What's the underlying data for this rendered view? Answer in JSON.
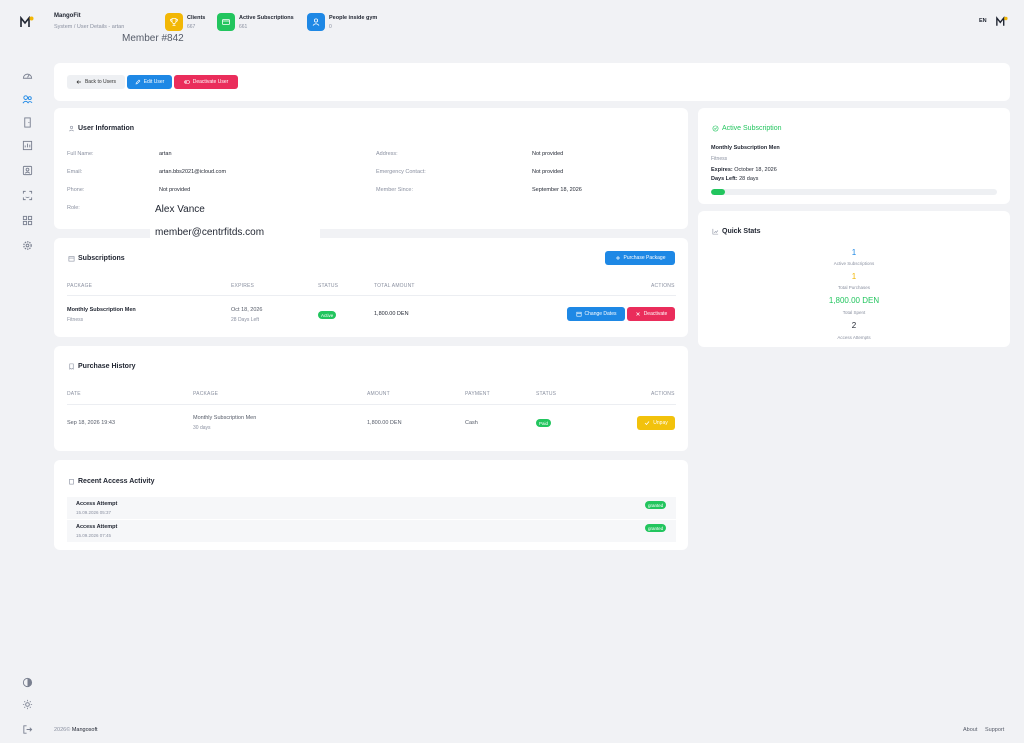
{
  "header": {
    "brand": "MangoFit",
    "breadcrumb": "System  /  User Details - artan",
    "member_label": "Member #842",
    "lang": "EN"
  },
  "stats": [
    {
      "title": "Clients",
      "count": "667",
      "color": "#f2b705",
      "icon": "trophy-icon"
    },
    {
      "title": "Active Subscriptions",
      "count": "661",
      "color": "#22c55e",
      "icon": "card-icon"
    },
    {
      "title": "People inside gym",
      "count": "0",
      "color": "#1e88e5",
      "icon": "person-icon"
    }
  ],
  "actions": {
    "back": "Back to Users",
    "edit": "Edit User",
    "deactivate": "Deactivate User"
  },
  "user_info": {
    "title": "User Information",
    "fields": {
      "full_name": {
        "label": "Full Name:",
        "value": "artan"
      },
      "email": {
        "label": "Email:",
        "value": "artan.bbs2021@icloud.com"
      },
      "phone": {
        "label": "Phone:",
        "value": "Not provided"
      },
      "role": {
        "label": "Role:"
      },
      "address": {
        "label": "Address:",
        "value": "Not provided"
      },
      "emergency": {
        "label": "Emergency Contact:",
        "value": "Not provided"
      },
      "member_since": {
        "label": "Member Since:",
        "value": "September 18, 2026"
      }
    },
    "overlay_name": "Alex Vance",
    "overlay_email": "member@centrfitds.com"
  },
  "subscriptions": {
    "title": "Subscriptions",
    "purchase_button": "Purchase Package",
    "headers": [
      "Package",
      "Expires",
      "Status",
      "Total Amount",
      "Actions"
    ],
    "row": {
      "package": "Monthly Subscription Men",
      "category": "Fitness",
      "expires": "Oct 18, 2026",
      "days_left": "28 Days Left",
      "status": "Active",
      "amount": "1,800.00 DEN",
      "change_dates": "Change Dates",
      "deactivate": "Deactivate"
    }
  },
  "purchase_history": {
    "title": "Purchase History",
    "headers": [
      "Date",
      "Package",
      "Amount",
      "Payment",
      "Status",
      "Actions"
    ],
    "row": {
      "date": "Sep 18, 2026 19:43",
      "package": "Monthly Subscription Men",
      "duration": "30 days",
      "amount": "1,800.00 DEN",
      "payment": "Cash",
      "status": "Paid",
      "action": "Unpay"
    }
  },
  "access_activity": {
    "title": "Recent Access Activity",
    "items": [
      {
        "title": "Access Attempt",
        "time": "15.09.2026 05:37",
        "status": "granted"
      },
      {
        "title": "Access Attempt",
        "time": "15.09.2026 07:45",
        "status": "granted"
      }
    ]
  },
  "active_subscription": {
    "title": "Active Subscription",
    "name": "Monthly Subscription Men",
    "category": "Fitness",
    "expires_label": "Expires:",
    "expires_value": "October 18, 2026",
    "days_label": "Days Left:",
    "days_value": "28 days",
    "progress_fraction": 0.05,
    "accent": "#22c55e"
  },
  "quick_stats": {
    "title": "Quick Stats",
    "items": [
      {
        "value": "1",
        "label": "Active Subscriptions",
        "color": "#1e88e5"
      },
      {
        "value": "1",
        "label": "Total Purchases",
        "color": "#f2b705"
      },
      {
        "value": "1,800.00 DEN",
        "label": "Total Spent",
        "color": "#22c55e"
      },
      {
        "value": "2",
        "label": "Access Attempts",
        "color": "#1f2430"
      }
    ]
  },
  "footer": {
    "year": "2026©",
    "company": "Mangosoft",
    "about": "About",
    "support": "Support"
  }
}
